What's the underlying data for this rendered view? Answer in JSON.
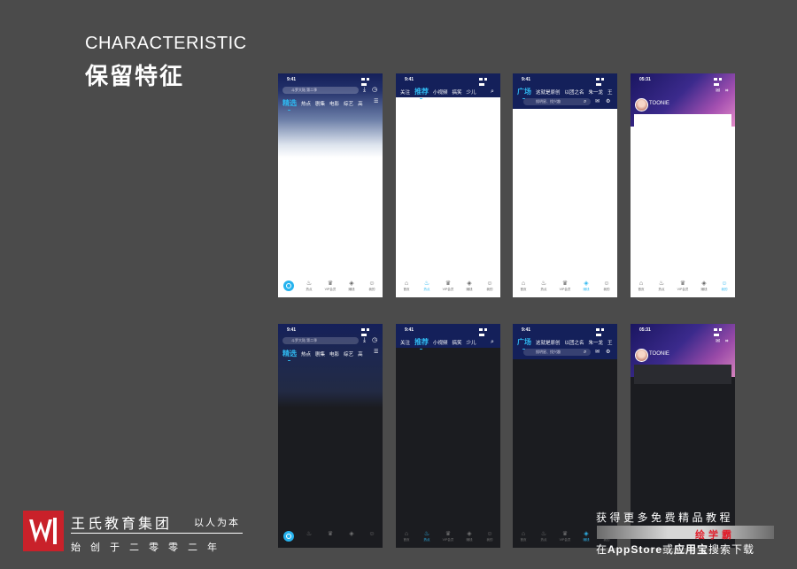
{
  "header": {
    "title_en": "CHARACTERISTIC",
    "title_cn": "保留特征"
  },
  "phones": {
    "status_time": "9:41",
    "status_time_alt": "05:31",
    "p1": {
      "search_placeholder": "斗罗大陆 第二季",
      "tabs": [
        "精选",
        "热点",
        "剧集",
        "电影",
        "综艺",
        "高"
      ],
      "tabbar": [
        "首页",
        "热点",
        "VIP会员",
        "赚钱",
        "我的"
      ]
    },
    "p2": {
      "tabs": [
        "关注",
        "推荐",
        "小视频",
        "搞笑",
        "少儿"
      ],
      "tabbar": [
        "首页",
        "热点",
        "VIP会员",
        "赚钱",
        "我的"
      ]
    },
    "p3": {
      "tabs": [
        "广场",
        "这就是原创",
        "以团之名",
        "朱一龙",
        "王"
      ],
      "search_placeholder": "搜明星、找兴趣",
      "tabbar": [
        "首页",
        "热点",
        "VIP会员",
        "赚钱",
        "我的"
      ]
    },
    "p4": {
      "username": "TOONIE",
      "tabbar": [
        "首页",
        "热点",
        "VIP会员",
        "赚钱",
        "我的"
      ]
    }
  },
  "footer": {
    "brand_name": "王氏教育集团",
    "slogan": "以人为本",
    "founded": "始创于二零零二年"
  },
  "promo": {
    "line1": "获得更多免费精品教程",
    "app_name": "绘学霸",
    "line3_pre": "在",
    "line3_store1": "AppStore",
    "line3_mid": "或",
    "line3_store2": "应用宝",
    "line3_post": "搜索下载"
  },
  "colors": {
    "page_bg": "#4b4b4b",
    "accent": "#2fb8f0",
    "logo_red": "#c9212a",
    "dark_screen": "#1b1c20"
  }
}
